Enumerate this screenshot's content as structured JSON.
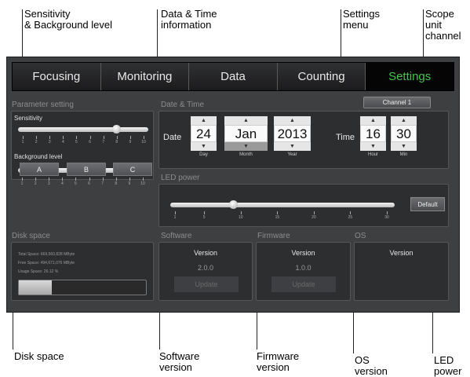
{
  "callouts": {
    "sensitivity": "Sensitivity\n& Background level",
    "datetime": "Data & Time\ninformation",
    "settings_menu": "Settings\nmenu",
    "scope": "Scope\nunit\nchannel",
    "disk": "Disk space",
    "software": "Software\nversion",
    "firmware": "Firmware\nversion",
    "os": "OS\nversion",
    "led": "LED\npower"
  },
  "tabs": [
    {
      "label": "Focusing"
    },
    {
      "label": "Monitoring"
    },
    {
      "label": "Data"
    },
    {
      "label": "Counting"
    },
    {
      "label": "Settings"
    }
  ],
  "active_tab": "Settings",
  "sections": {
    "parameter": "Parameter setting",
    "datetime": "Date & Time",
    "led": "LED power",
    "disk": "Disk space",
    "software": "Software",
    "firmware": "Firmware",
    "os": "OS"
  },
  "channel_button": "Channel 1",
  "sensitivity": {
    "label": "Sensitivity",
    "value": 8,
    "min": 1,
    "max": 10,
    "ticks": [
      "1",
      "2",
      "3",
      "4",
      "5",
      "6",
      "7",
      "8",
      "9",
      "10"
    ]
  },
  "background": {
    "label": "Background level",
    "value": 2,
    "min": 1,
    "max": 10,
    "ticks": [
      "1",
      "2",
      "3",
      "4",
      "5",
      "6",
      "7",
      "8",
      "9",
      "10"
    ]
  },
  "presets": [
    "A",
    "B",
    "C"
  ],
  "date": {
    "label": "Date",
    "day": "24",
    "month": "Jan",
    "year": "2013",
    "day_label": "Day",
    "month_label": "Month",
    "year_label": "Year"
  },
  "time": {
    "label": "Time",
    "hour": "16",
    "min": "30",
    "hour_label": "Hour",
    "min_label": "Min"
  },
  "led": {
    "value": 9,
    "min": 1,
    "max": 30,
    "ticks": [
      "1",
      "5",
      "10",
      "15",
      "20",
      "25",
      "30"
    ],
    "default_label": "Default"
  },
  "disk": {
    "total": "Total Space: 669,560,828 MByte",
    "free": "Free Space: 494,671,076 MByte",
    "usage": "Usage Space: 26.12 %",
    "usage_fraction": 0.2612
  },
  "software": {
    "title": "Version",
    "version": "2.0.0",
    "update": "Update"
  },
  "firmware": {
    "title": "Version",
    "version": "1.0.0",
    "update": "Update"
  },
  "os": {
    "title": "Version"
  },
  "colors": {
    "accent_green": "#43c64b",
    "panel": "#2d2e30",
    "background": "#3e3f41"
  }
}
